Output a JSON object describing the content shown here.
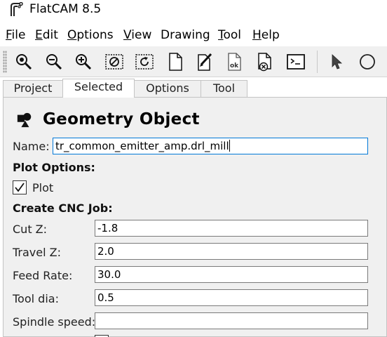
{
  "window": {
    "title": "FlatCAM 8.5"
  },
  "menu": [
    {
      "label": "File",
      "mnemonic": "F",
      "rest": "ile"
    },
    {
      "label": "Edit",
      "mnemonic": "E",
      "rest": "dit"
    },
    {
      "label": "Options",
      "mnemonic": "O",
      "rest": "ptions"
    },
    {
      "label": "View",
      "mnemonic": "V",
      "rest": "iew"
    },
    {
      "label": "Drawing",
      "mnemonic": "",
      "rest": "Drawing"
    },
    {
      "label": "Tool",
      "mnemonic": "T",
      "rest": "ool"
    },
    {
      "label": "Help",
      "mnemonic": "H",
      "rest": "elp"
    }
  ],
  "toolbar": {
    "buttons": [
      "zoom-fit-icon",
      "zoom-out-icon",
      "zoom-in-icon",
      "clear-plot-icon",
      "replot-icon",
      "new-project-icon",
      "edit-geometry-icon",
      "update-geometry-icon",
      "delete-icon",
      "shell-icon",
      "select-icon",
      "circle-icon"
    ]
  },
  "tabs": {
    "project": "Project",
    "selected": "Selected",
    "options": "Options",
    "tool": "Tool",
    "active": "Selected"
  },
  "object": {
    "title": "Geometry Object",
    "name_label": "Name:",
    "name_value": "tr_common_emitter_amp.drl_mill",
    "plot_options_label": "Plot Options:",
    "plot_checkbox_label": "Plot",
    "plot_checked": true,
    "cnc_label": "Create CNC Job:",
    "fields": [
      {
        "label": "Cut Z:",
        "value": "-1.8"
      },
      {
        "label": "Travel Z:",
        "value": "2.0"
      },
      {
        "label": "Feed Rate:",
        "value": "30.0"
      },
      {
        "label": "Tool dia:",
        "value": "0.5"
      },
      {
        "label": "Spindle speed:",
        "value": ""
      }
    ]
  },
  "colors": {
    "accent": "#0078d7",
    "panel_bg": "#f0f0f0",
    "toolbar_bg": "#f0f0f0"
  }
}
